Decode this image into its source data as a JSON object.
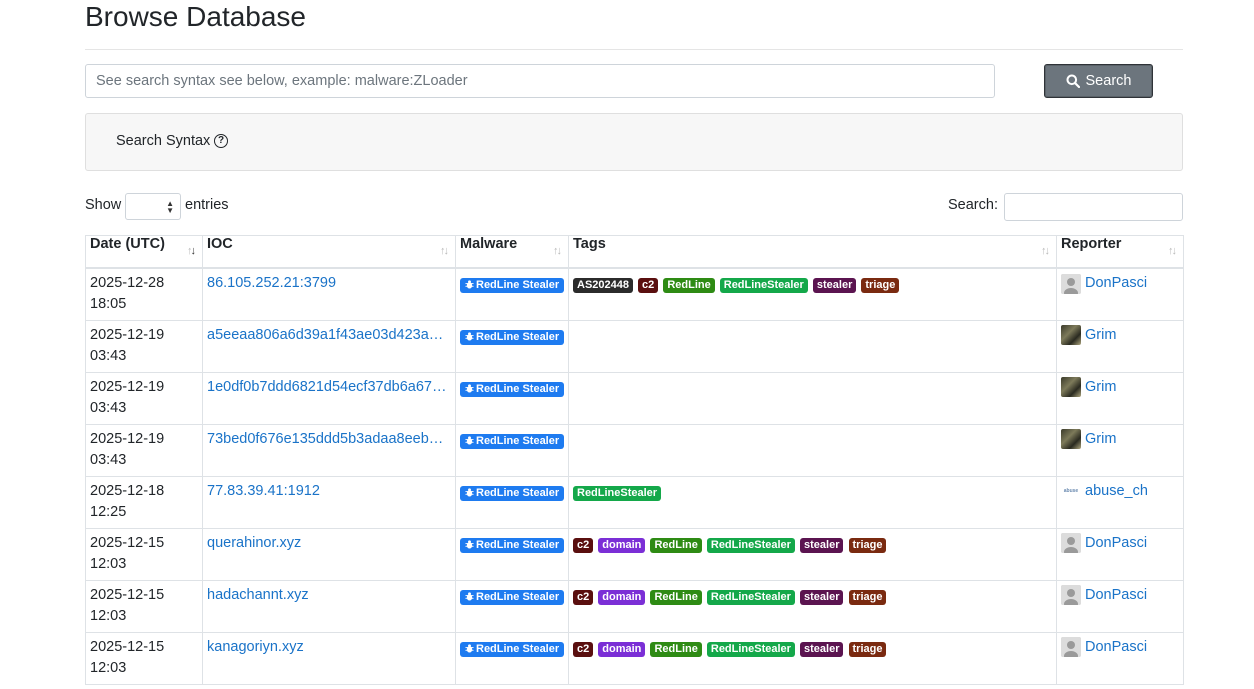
{
  "page": {
    "title": "Browse Database"
  },
  "search": {
    "placeholder": "See search syntax see below, example: malware:ZLoader",
    "button_label": "Search"
  },
  "syntax": {
    "label": "Search Syntax"
  },
  "table_controls": {
    "show_label": "Show",
    "entries_label": "entries",
    "search_label": "Search:"
  },
  "columns": [
    "Date (UTC)",
    "IOC",
    "Malware",
    "Tags",
    "Reporter"
  ],
  "colors": {
    "malware_badge": "#1e7bf0",
    "tag_AS202448": "#2b2b2b",
    "tag_c2": "#5a0f0f",
    "tag_RedLine": "#2e8b14",
    "tag_RedLineStealer": "#14a84a",
    "tag_stealer": "#5b1450",
    "tag_triage": "#7a2a10",
    "tag_domain": "#7b2fd6",
    "link": "#1a73c8"
  },
  "rows": [
    {
      "date": "2025-12-28",
      "time": "18:05",
      "ioc": "86.105.252.21:3799",
      "malware": "RedLine Stealer",
      "tags": [
        "AS202448",
        "c2",
        "RedLine",
        "RedLineStealer",
        "stealer",
        "triage"
      ],
      "reporter": "DonPasci",
      "avatar": "default"
    },
    {
      "date": "2025-12-19",
      "time": "03:43",
      "ioc": "a5eeaa806a6d39a1f43ae03d423a6…",
      "malware": "RedLine Stealer",
      "tags": [],
      "reporter": "Grim",
      "avatar": "grim"
    },
    {
      "date": "2025-12-19",
      "time": "03:43",
      "ioc": "1e0df0b7ddd6821d54ecf37db6a67…",
      "malware": "RedLine Stealer",
      "tags": [],
      "reporter": "Grim",
      "avatar": "grim"
    },
    {
      "date": "2025-12-19",
      "time": "03:43",
      "ioc": "73bed0f676e135ddd5b3adaa8eebe…",
      "malware": "RedLine Stealer",
      "tags": [],
      "reporter": "Grim",
      "avatar": "grim"
    },
    {
      "date": "2025-12-18",
      "time": "12:25",
      "ioc": "77.83.39.41:1912",
      "malware": "RedLine Stealer",
      "tags": [
        "RedLineStealer"
      ],
      "reporter": "abuse_ch",
      "avatar": "abusech"
    },
    {
      "date": "2025-12-15",
      "time": "12:03",
      "ioc": "querahinor.xyz",
      "malware": "RedLine Stealer",
      "tags": [
        "c2",
        "domain",
        "RedLine",
        "RedLineStealer",
        "stealer",
        "triage"
      ],
      "reporter": "DonPasci",
      "avatar": "default"
    },
    {
      "date": "2025-12-15",
      "time": "12:03",
      "ioc": "hadachannt.xyz",
      "malware": "RedLine Stealer",
      "tags": [
        "c2",
        "domain",
        "RedLine",
        "RedLineStealer",
        "stealer",
        "triage"
      ],
      "reporter": "DonPasci",
      "avatar": "default"
    },
    {
      "date": "2025-12-15",
      "time": "12:03",
      "ioc": "kanagoriyn.xyz",
      "malware": "RedLine Stealer",
      "tags": [
        "c2",
        "domain",
        "RedLine",
        "RedLineStealer",
        "stealer",
        "triage"
      ],
      "reporter": "DonPasci",
      "avatar": "default"
    }
  ]
}
